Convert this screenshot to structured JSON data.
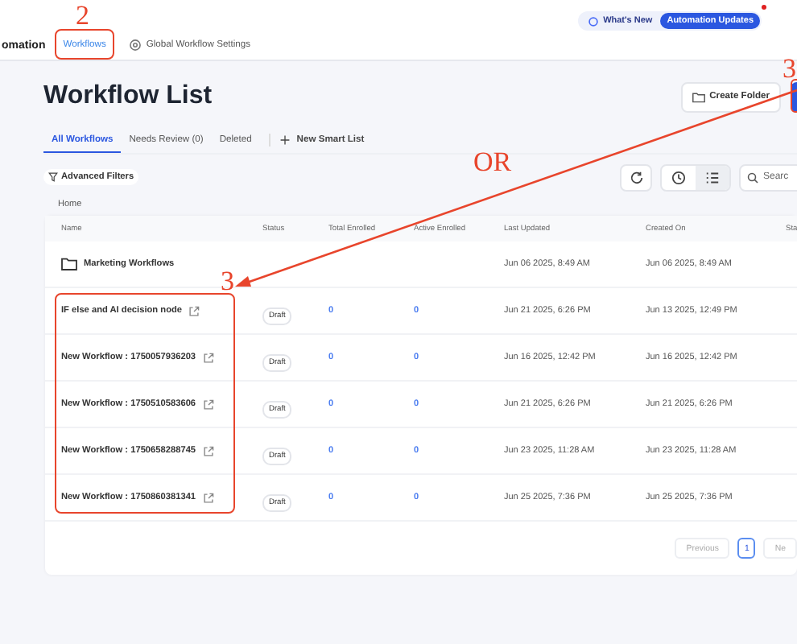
{
  "app_title": "omation",
  "nav_tabs": [
    {
      "label": "Workflows",
      "selected": true
    },
    {
      "label": "Global Workflow Settings",
      "selected": false
    }
  ],
  "whats_new": {
    "label": "What's New",
    "badge": "Automation Updates",
    "notification": true
  },
  "page_title": "Workflow List",
  "create_folder": "Create Folder",
  "list_tabs": [
    {
      "label": "All Workflows",
      "selected": true
    },
    {
      "label": "Needs Review (0)",
      "selected": false
    },
    {
      "label": "Deleted",
      "selected": false
    }
  ],
  "new_smart_list": "New Smart List",
  "advanced_filters": "Advanced Filters",
  "views": [
    {
      "kind": "clock",
      "selected": false
    },
    {
      "kind": "list",
      "selected": true
    }
  ],
  "search": {
    "placeholder": "Searc"
  },
  "breadcrumb": "Home",
  "table": {
    "columns": [
      "Name",
      "Status",
      "Total Enrolled",
      "Active Enrolled",
      "Last Updated",
      "Created On",
      "Sta"
    ],
    "rows": [
      {
        "kind": "folder",
        "name": "Marketing Workflows",
        "last_updated": "Jun 06 2025, 8:49 AM",
        "created_on": "Jun 06 2025, 8:49 AM"
      },
      {
        "kind": "workflow",
        "name": "IF else and AI decision node",
        "status": "Draft",
        "total_enrolled": "0",
        "active_enrolled": "0",
        "last_updated": "Jun 21 2025, 6:26 PM",
        "created_on": "Jun 13 2025, 12:49 PM"
      },
      {
        "kind": "workflow",
        "name": "New Workflow : 1750057936203",
        "status": "Draft",
        "total_enrolled": "0",
        "active_enrolled": "0",
        "last_updated": "Jun 16 2025, 12:42 PM",
        "created_on": "Jun 16 2025, 12:42 PM"
      },
      {
        "kind": "workflow",
        "name": "New Workflow : 1750510583606",
        "status": "Draft",
        "total_enrolled": "0",
        "active_enrolled": "0",
        "last_updated": "Jun 21 2025, 6:26 PM",
        "created_on": "Jun 21 2025, 6:26 PM"
      },
      {
        "kind": "workflow",
        "name": "New Workflow : 1750658288745",
        "status": "Draft",
        "total_enrolled": "0",
        "active_enrolled": "0",
        "last_updated": "Jun 23 2025, 11:28 AM",
        "created_on": "Jun 23 2025, 11:28 AM"
      },
      {
        "kind": "workflow",
        "name": "New Workflow : 1750860381341",
        "status": "Draft",
        "total_enrolled": "0",
        "active_enrolled": "0",
        "last_updated": "Jun 25 2025, 7:36 PM",
        "created_on": "Jun 25 2025, 7:36 PM"
      }
    ]
  },
  "pagination": {
    "previous": "Previous",
    "pages": [
      {
        "label": "1",
        "selected": true
      }
    ],
    "next": "Ne"
  },
  "annotations": {
    "nav_number": "2",
    "button_number": "3",
    "or": "OR",
    "list_number": "3"
  }
}
